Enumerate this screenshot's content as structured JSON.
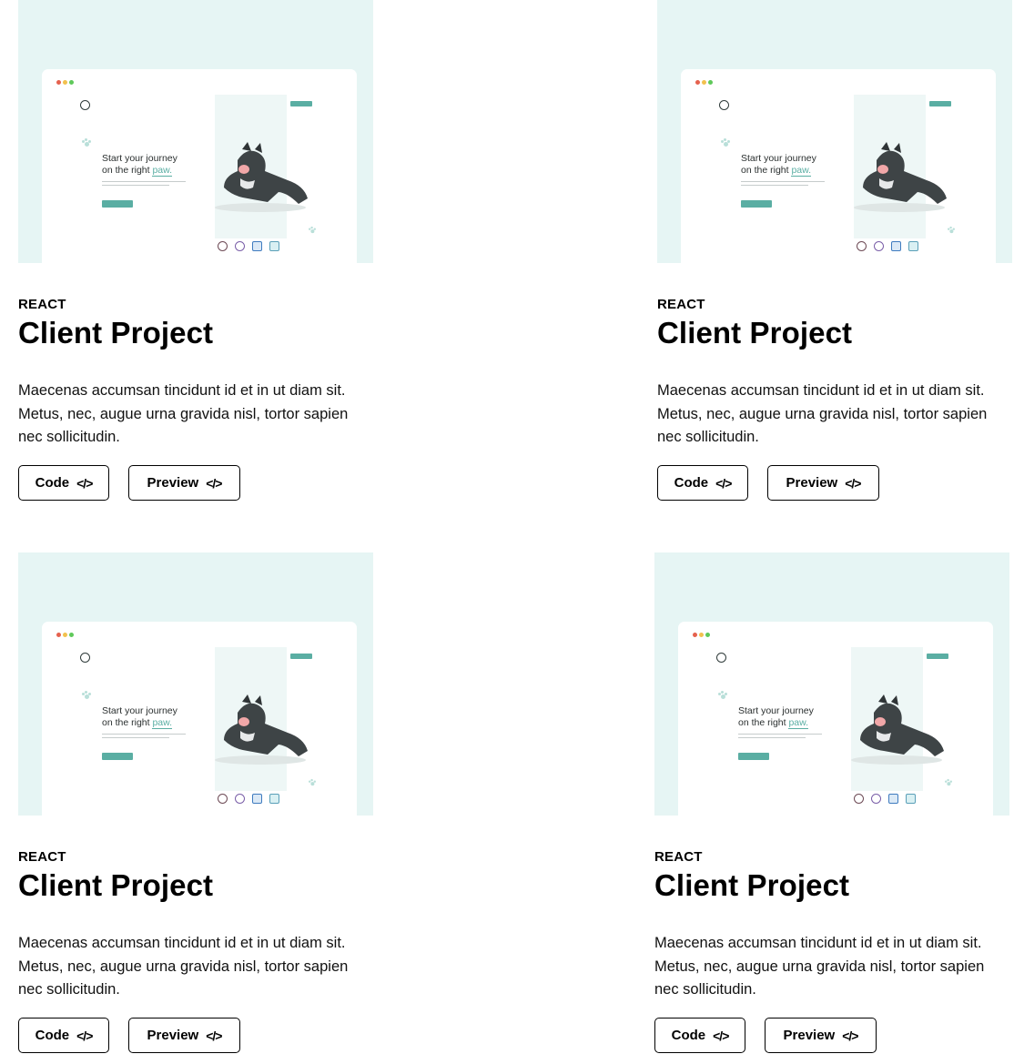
{
  "projects": [
    {
      "category": "REACT",
      "title": "Client Project",
      "description": "Maecenas accumsan tincidunt id et in ut diam sit.\nMetus, nec, augue urna gravida nisl, tortor sapien\nnec sollicitudin.",
      "code_label": "Code",
      "preview_label": "Preview",
      "code_icon": "code-brackets-icon",
      "thumbnail": {
        "hero_line1": "Start your journey",
        "hero_line2": "on the right",
        "hero_accent": "paw.",
        "accent_color": "#5aaea3",
        "background_color": "#e6f5f4"
      }
    },
    {
      "category": "REACT",
      "title": "Client Project",
      "description": "Maecenas accumsan tincidunt id et in ut diam sit.\nMetus, nec, augue urna gravida nisl, tortor sapien\nnec sollicitudin.",
      "code_label": "Code",
      "preview_label": "Preview",
      "code_icon": "code-brackets-icon",
      "thumbnail": {
        "hero_line1": "Start your journey",
        "hero_line2": "on the right",
        "hero_accent": "paw.",
        "accent_color": "#5aaea3",
        "background_color": "#e6f5f4"
      }
    },
    {
      "category": "REACT",
      "title": "Client Project",
      "description": "Maecenas accumsan tincidunt id et in ut diam sit.\nMetus, nec, augue urna gravida nisl, tortor sapien\nnec sollicitudin.",
      "code_label": "Code",
      "preview_label": "Preview",
      "code_icon": "code-brackets-icon",
      "thumbnail": {
        "hero_line1": "Start your journey",
        "hero_line2": "on the right",
        "hero_accent": "paw.",
        "accent_color": "#5aaea3",
        "background_color": "#e6f5f4"
      }
    },
    {
      "category": "REACT",
      "title": "Client Project",
      "description": "Maecenas accumsan tincidunt id et in ut diam sit.\nMetus, nec, augue urna gravida nisl, tortor sapien\nnec sollicitudin.",
      "code_label": "Code",
      "preview_label": "Preview",
      "code_icon": "code-brackets-icon",
      "thumbnail": {
        "hero_line1": "Start your journey",
        "hero_line2": "on the right",
        "hero_accent": "paw.",
        "accent_color": "#5aaea3",
        "background_color": "#e6f5f4"
      }
    }
  ]
}
